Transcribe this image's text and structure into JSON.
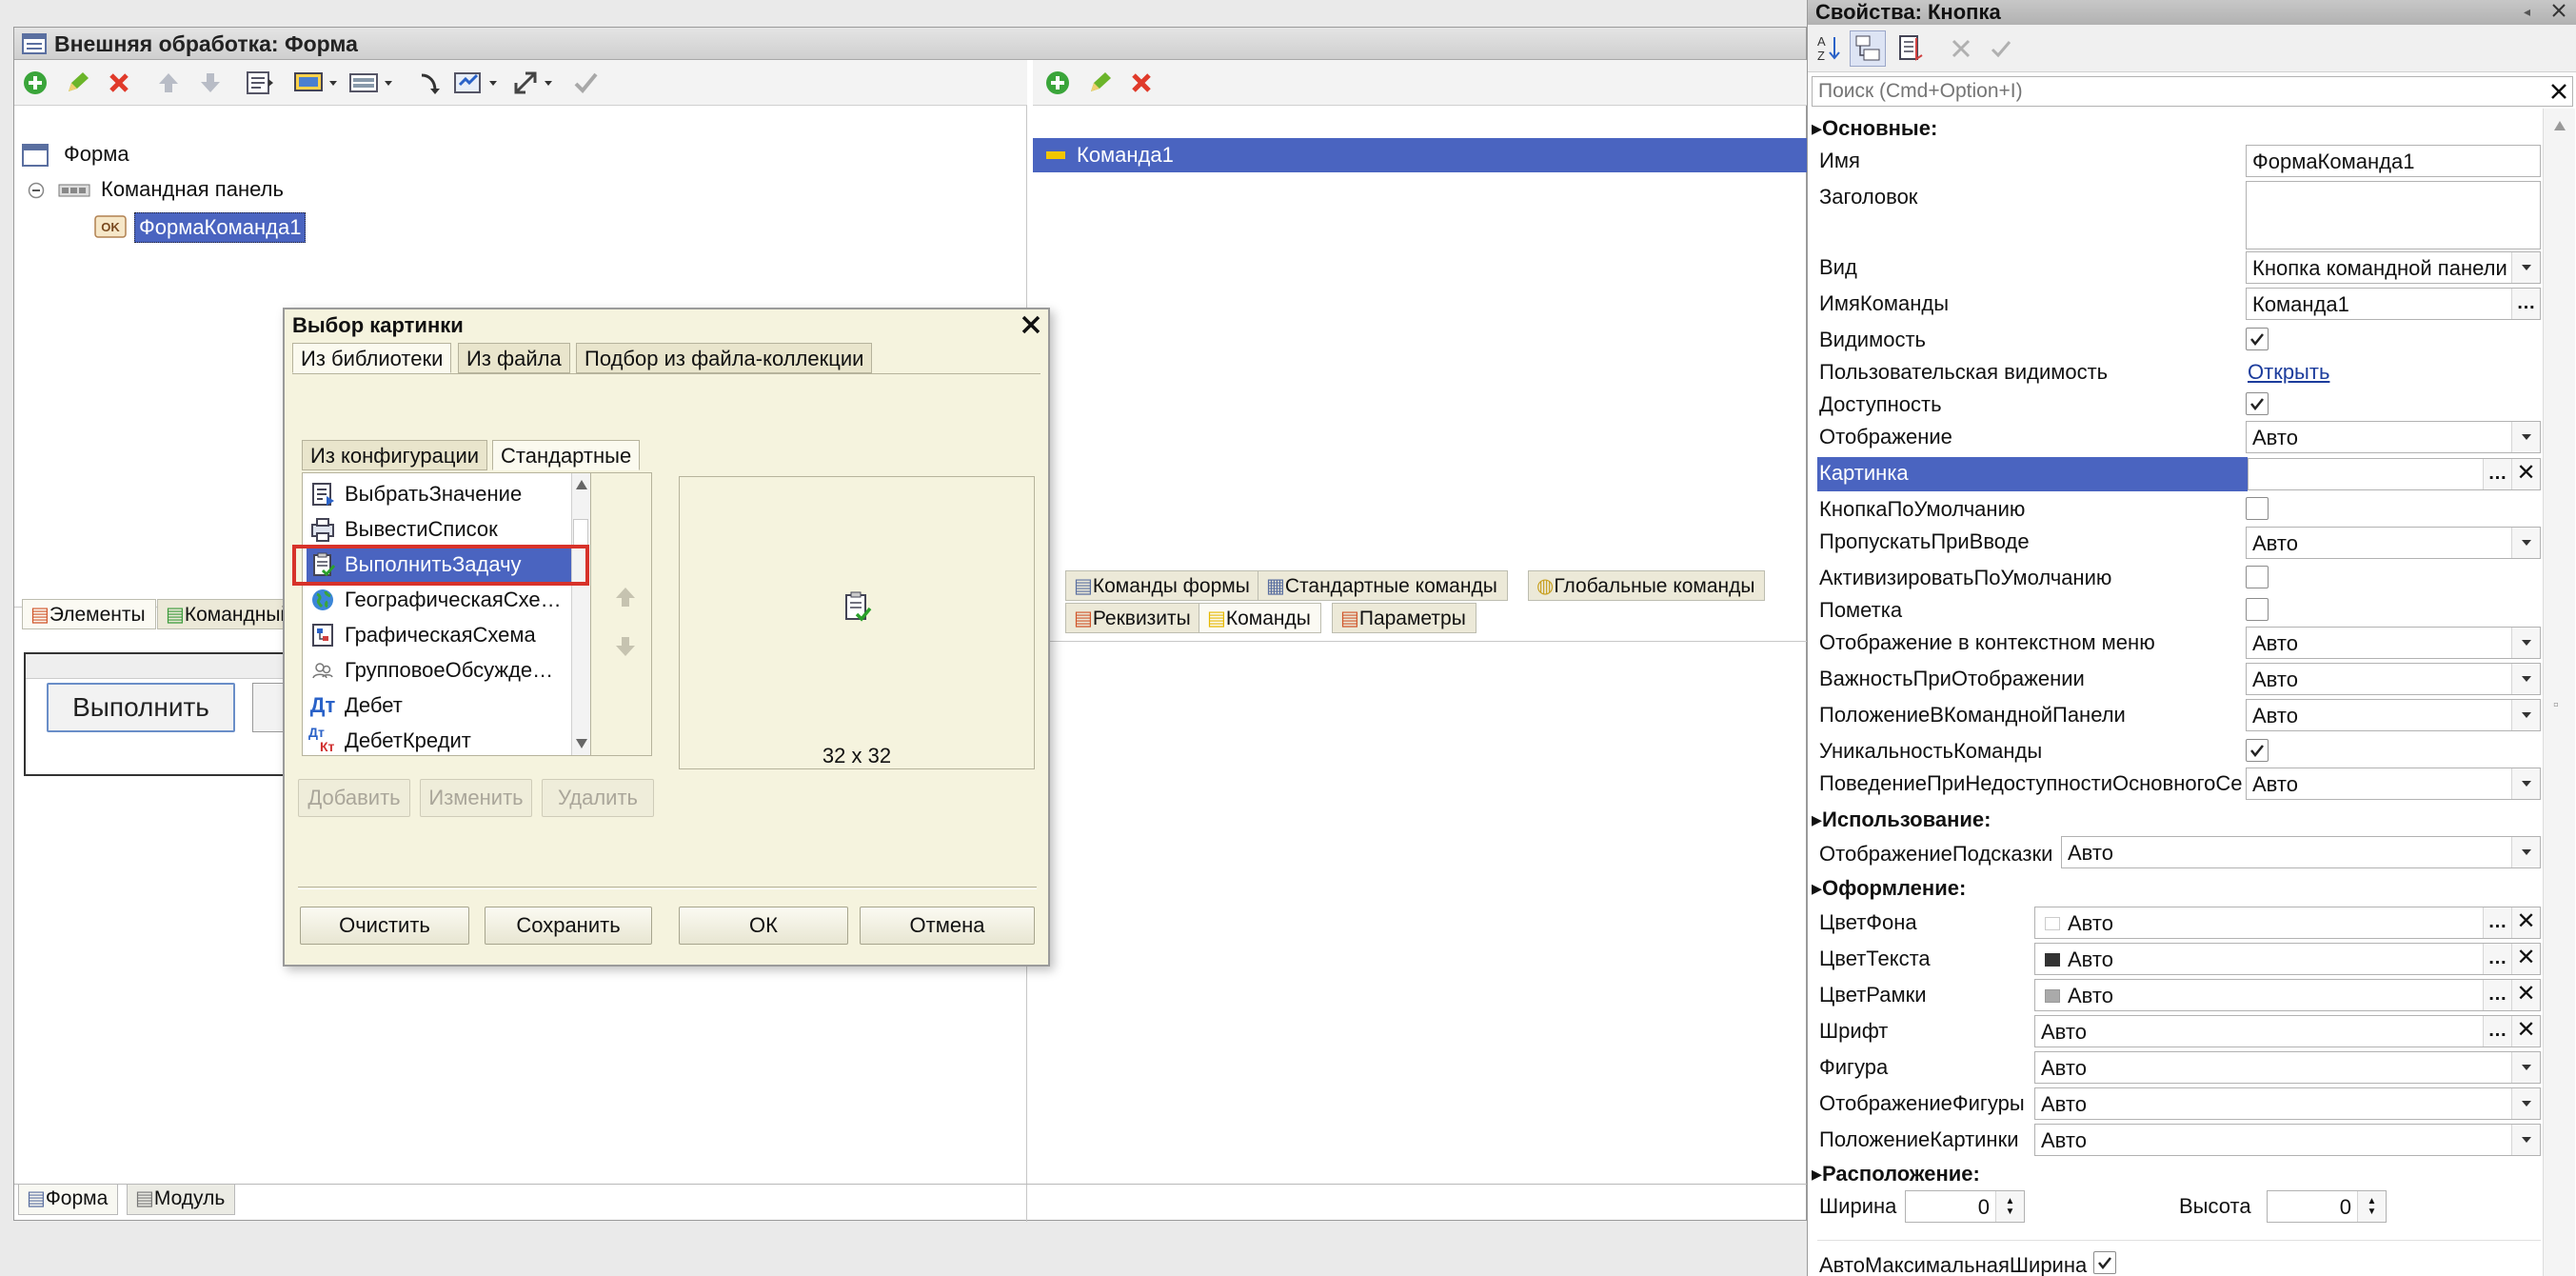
{
  "form_window": {
    "title": "Внешняя обработка: Форма",
    "tree": {
      "root": "Форма",
      "command_bar": "Командная панель",
      "button": "ФормаКоманда1"
    },
    "left_tabs": [
      "Элементы",
      "Командный интерфейс"
    ],
    "preview_button": "Выполнить",
    "commands_list": [
      "Команда1"
    ],
    "right_tabs_row1": [
      "Команды формы",
      "Стандартные команды",
      "Глобальные команды"
    ],
    "right_tabs_row2": [
      "Реквизиты",
      "Команды",
      "Параметры"
    ],
    "bottom_tabs": [
      "Форма",
      "Модуль"
    ]
  },
  "dialog": {
    "title": "Выбор картинки",
    "tabs": [
      "Из библиотеки",
      "Из файла",
      "Подбор из файла-коллекции"
    ],
    "subtabs": [
      "Из конфигурации",
      "Стандартные"
    ],
    "items": [
      {
        "label": "ВыбратьЗначение",
        "icon": "select-value-icon"
      },
      {
        "label": "ВывестиСписок",
        "icon": "print-list-icon"
      },
      {
        "label": "ВыполнитьЗадачу",
        "icon": "execute-task-icon",
        "selected": true
      },
      {
        "label": "ГеографическаяСхе…",
        "icon": "globe-icon"
      },
      {
        "label": "ГрафическаяСхема",
        "icon": "graphic-scheme-icon"
      },
      {
        "label": "ГрупповоеОбсужде…",
        "icon": "group-discussion-icon"
      },
      {
        "label": "Дебет",
        "icon": "debit-icon"
      },
      {
        "label": "ДебетКредит",
        "icon": "debit-credit-icon"
      }
    ],
    "preview_size": "32 x 32",
    "debit_glyph": "Дт",
    "credit_glyph": "Кт",
    "buttons": {
      "add": "Добавить",
      "edit": "Изменить",
      "delete": "Удалить",
      "clear": "Очистить",
      "save": "Сохранить",
      "ok": "ОК",
      "cancel": "Отмена"
    }
  },
  "properties": {
    "title": "Свойства: Кнопка",
    "search_placeholder": "Поиск (Cmd+Option+I)",
    "sections": {
      "main": "Основные:",
      "usage": "Использование:",
      "appearance": "Оформление:",
      "position": "Расположение:"
    },
    "rows": {
      "name": {
        "label": "Имя",
        "value": "ФормаКоманда1"
      },
      "caption": {
        "label": "Заголовок",
        "value": ""
      },
      "kind": {
        "label": "Вид",
        "value": "Кнопка командной панели"
      },
      "command_name": {
        "label": "ИмяКоманды",
        "value": "Команда1"
      },
      "visible": {
        "label": "Видимость",
        "checked": true
      },
      "user_visibility": {
        "label": "Пользовательская видимость",
        "value": "Открыть"
      },
      "enabled": {
        "label": "Доступность",
        "checked": true
      },
      "display": {
        "label": "Отображение",
        "value": "Авто"
      },
      "picture": {
        "label": "Картинка",
        "value": ""
      },
      "default_button": {
        "label": "КнопкаПоУмолчанию",
        "checked": false
      },
      "skip_on_input": {
        "label": "ПропускатьПриВводе",
        "value": "Авто"
      },
      "activate_default": {
        "label": "АктивизироватьПоУмолчанию",
        "checked": false
      },
      "mark": {
        "label": "Пометка",
        "checked": false
      },
      "context_menu_display": {
        "label": "Отображение в контекстном меню",
        "value": "Авто"
      },
      "display_importance": {
        "label": "ВажностьПриОтображении",
        "value": "Авто"
      },
      "command_bar_location": {
        "label": "ПоложениеВКоманднойПанели",
        "value": "Авто"
      },
      "command_uniqueness": {
        "label": "УникальностьКоманды",
        "checked": true
      },
      "unavailable_behavior": {
        "label": "ПоведениеПриНедоступностиОсновногоСе",
        "value": "Авто"
      },
      "tooltip_display": {
        "label": "ОтображениеПодсказки",
        "value": "Авто"
      },
      "back_color": {
        "label": "ЦветФона",
        "value": "Авто"
      },
      "text_color": {
        "label": "ЦветТекста",
        "value": "Авто"
      },
      "border_color": {
        "label": "ЦветРамки",
        "value": "Авто"
      },
      "font": {
        "label": "Шрифт",
        "value": "Авто"
      },
      "shape": {
        "label": "Фигура",
        "value": "Авто"
      },
      "shape_display": {
        "label": "ОтображениеФигуры",
        "value": "Авто"
      },
      "picture_location": {
        "label": "ПоложениеКартинки",
        "value": "Авто"
      },
      "width": {
        "label": "Ширина",
        "value": "0"
      },
      "height": {
        "label": "Высота",
        "value": "0"
      },
      "auto_max_width": {
        "label": "АвтоМаксимальнаяШирина",
        "checked": true
      }
    }
  },
  "colors": {
    "selection": "#4a64c0",
    "dialog_bg": "#f5f3de",
    "highlight_border": "#d7322a"
  }
}
